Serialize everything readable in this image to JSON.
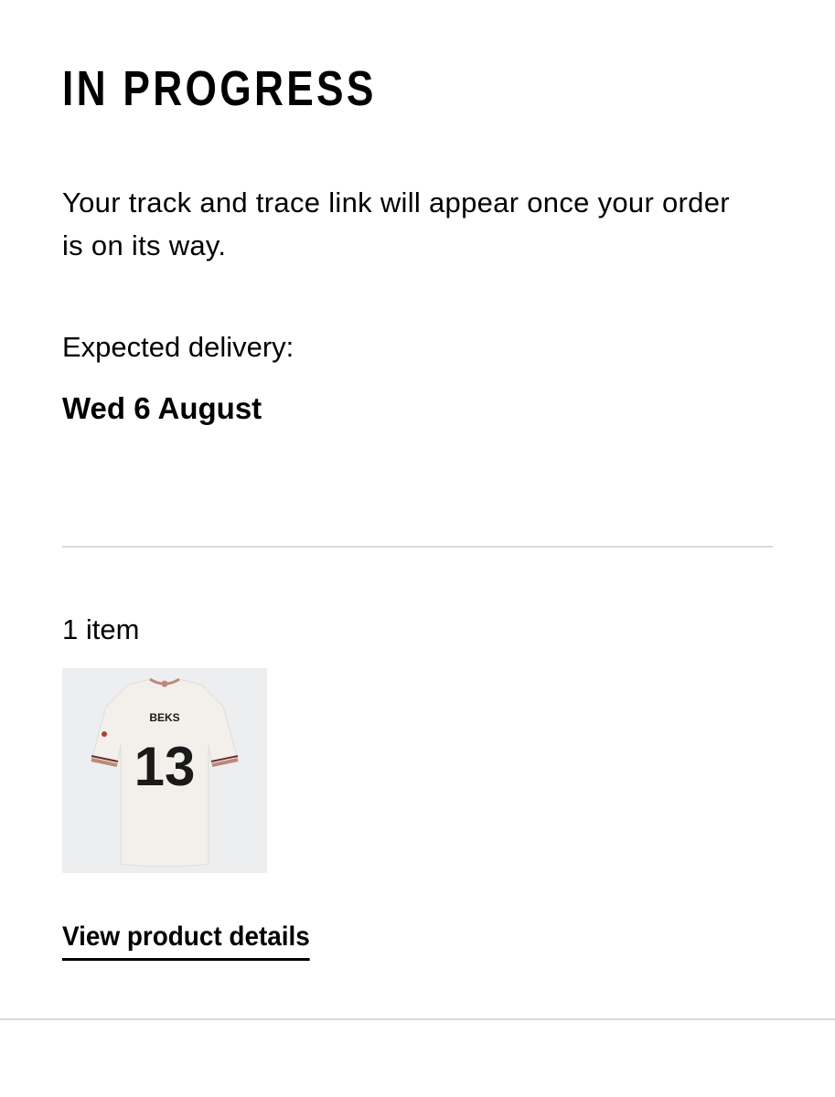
{
  "order_status": {
    "title": "IN PROGRESS",
    "message": "Your track and trace link will appear once your order is on its way.",
    "delivery_label": "Expected delivery:",
    "delivery_date": "Wed 6 August"
  },
  "items": {
    "count_label": "1 item",
    "products": [
      {
        "image_icon": "football-shirt-image",
        "shirt_name": "BEKS",
        "shirt_number": "13",
        "details_link": "View product details"
      }
    ]
  },
  "colors": {
    "text": "#000000",
    "divider": "#d9d9d9",
    "thumb_background": "#eceeef",
    "shirt": "#f3f0ec",
    "shirt_trim": "#b98a78"
  }
}
